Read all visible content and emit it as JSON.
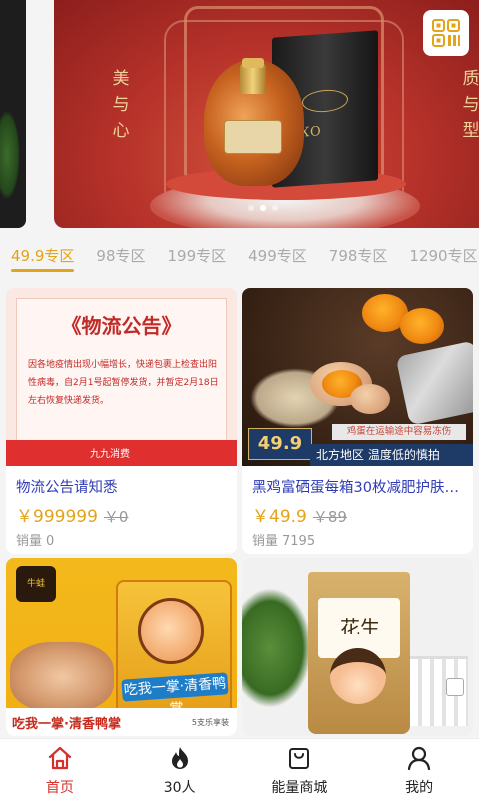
{
  "colors": {
    "accent": "#e3a41b",
    "nav_active": "#d5302c",
    "product_title": "#2f3cb3",
    "muted": "#999999"
  },
  "banner": {
    "left_vertical_text": [
      "美",
      "与",
      "心"
    ],
    "right_vertical_text": [
      "质",
      "与",
      "型"
    ],
    "box_text": "XO",
    "slide_count": 3,
    "active_slide": 2,
    "qr_icon": "qr-code-icon"
  },
  "tabs": [
    {
      "label": "49.9专区",
      "active": true
    },
    {
      "label": "98专区",
      "active": false
    },
    {
      "label": "199专区",
      "active": false
    },
    {
      "label": "499专区",
      "active": false
    },
    {
      "label": "798专区",
      "active": false
    },
    {
      "label": "1290专区",
      "active": false
    }
  ],
  "products": [
    {
      "name": "物流公告请知悉",
      "price": "￥999999",
      "original_price": "￥0",
      "sold_label": "销量",
      "sold_count": "0",
      "image": {
        "title": "《物流公告》",
        "body": "因各地疫情出现小幅增长，快递包裹上检查出阳性病毒，自2月1号起暂停发货，并暂定2月18日左右恢复快递发货。",
        "logo": "九九消费"
      }
    },
    {
      "name": "黑鸡富硒蛋每箱30枚减肥护肤营养早餐",
      "price": "￥49.9",
      "original_price": "￥89",
      "sold_label": "销量",
      "sold_count": "7195",
      "image": {
        "tag": "49.9",
        "warning": "鸡蛋在运输途中容易冻伤",
        "strip": "北方地区 温度低的慎拍"
      }
    },
    {
      "name": "",
      "image": {
        "brand": "牛蛙",
        "bag_title": "吃我一掌·清香鸭掌",
        "bottom_text": "吃我一掌·清香鸭掌",
        "bottom_small": "5支乐享装"
      }
    },
    {
      "name": "",
      "image": {
        "bag_name": "花生"
      }
    }
  ],
  "bottom_nav": [
    {
      "label": "首页",
      "icon": "home-icon",
      "active": true
    },
    {
      "label": "30人",
      "icon": "fire-icon",
      "active": false
    },
    {
      "label": "能量商城",
      "icon": "shopping-bag-icon",
      "active": false
    },
    {
      "label": "我的",
      "icon": "user-icon",
      "active": false
    }
  ]
}
